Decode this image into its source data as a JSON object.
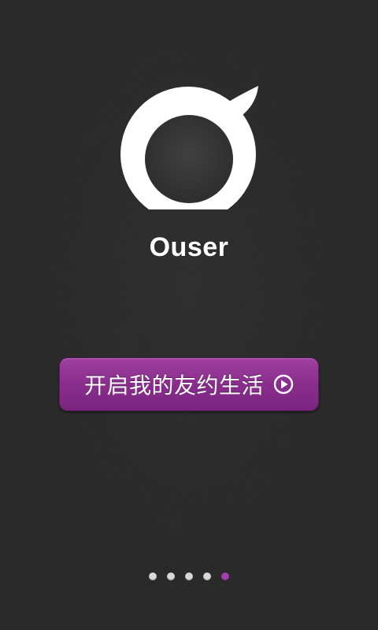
{
  "app": {
    "name": "Ouser"
  },
  "start_button": {
    "label": "开启我的友约生活",
    "icon": "play-circle-icon"
  },
  "pager": {
    "total_pages": 5,
    "current_page": 5
  },
  "colors": {
    "background": "#2a2a2a",
    "accent": "#8a2e8d",
    "active_dot": "#a43fb2",
    "inactive_dot": "#d9d9d9",
    "logo_fill": "#ffffff",
    "logo_center": "#3a3a3a"
  }
}
